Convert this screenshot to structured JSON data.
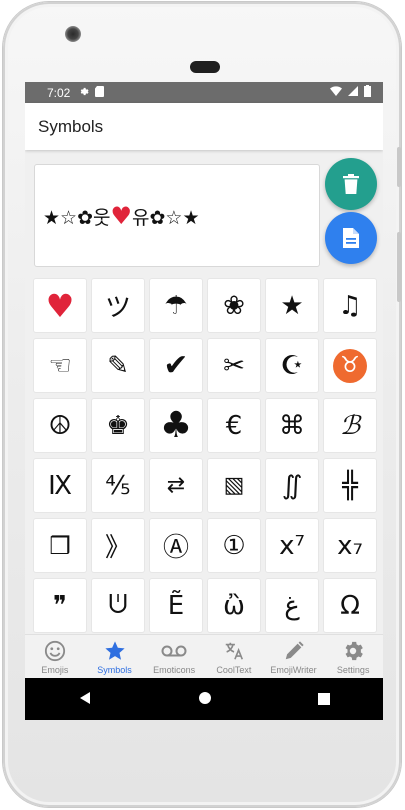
{
  "status": {
    "time": "7:02"
  },
  "appbar": {
    "title": "Symbols"
  },
  "composer": {
    "text": "★☆✿웃♥유✿☆★"
  },
  "grid": [
    [
      "♥",
      "ツ",
      "☂",
      "❀",
      "★",
      "♫"
    ],
    [
      "☜",
      "✎",
      "✔",
      "✂",
      "☪",
      "♉"
    ],
    [
      "☮",
      "♚",
      "♣",
      "€",
      "⌘",
      "ℬ"
    ],
    [
      "Ⅸ",
      "⅘",
      "⇄",
      "▧",
      "∬",
      "╬"
    ],
    [
      "❒",
      "》",
      "Ⓐ",
      "①",
      "x⁷",
      "x₇"
    ],
    [
      "❞",
      "ᕫ",
      "Ẽ",
      "ὢ",
      "ﻍ",
      "Ω"
    ]
  ],
  "nav": [
    {
      "label": "Emojis",
      "icon": "smiley-icon",
      "active": false
    },
    {
      "label": "Symbols",
      "icon": "star-icon",
      "active": true
    },
    {
      "label": "Emoticons",
      "icon": "voicemail-icon",
      "active": false
    },
    {
      "label": "CoolText",
      "icon": "translate-icon",
      "active": false
    },
    {
      "label": "EmojiWriter",
      "icon": "pencil-icon",
      "active": false
    },
    {
      "label": "Settings",
      "icon": "gear-icon",
      "active": false
    }
  ],
  "colors": {
    "active_tab": "#2f6fe0",
    "delete_fab": "#239f8e",
    "copy_fab": "#2f80ee",
    "heart": "#e0243a",
    "taurus_badge": "#ef6a2f"
  }
}
